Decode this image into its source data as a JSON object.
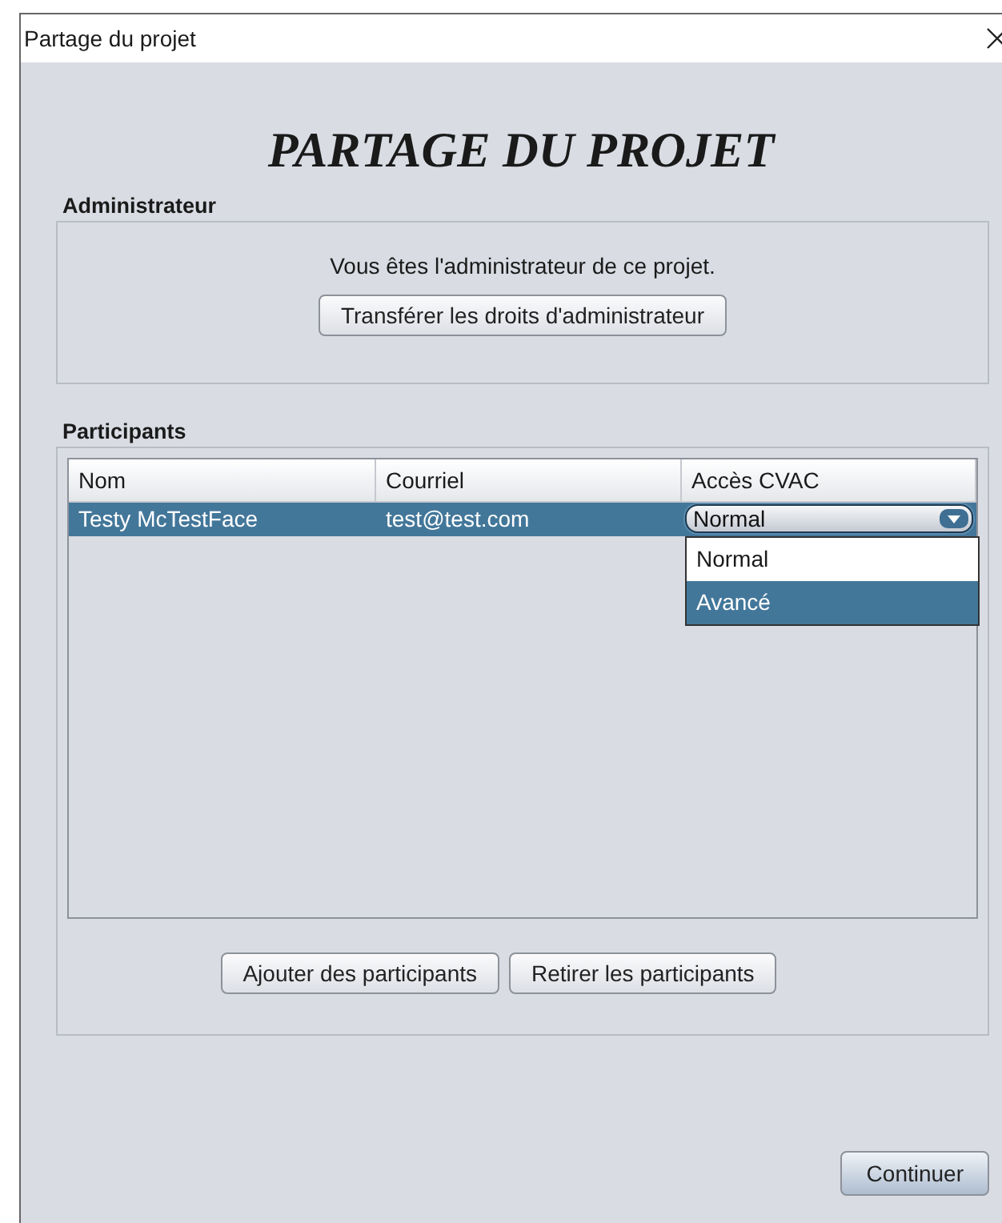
{
  "window": {
    "title": "Partage du projet"
  },
  "heading": "PARTAGE DU PROJET",
  "admin": {
    "label": "Administrateur",
    "message": "Vous êtes l'administrateur de ce projet.",
    "button": "Transférer les droits d'administrateur"
  },
  "participants": {
    "label": "Participants",
    "table": {
      "columns": [
        "Nom",
        "Courriel",
        "Accès CVAC"
      ],
      "rows": [
        {
          "name": "Testy McTestFace",
          "email": "test@test.com",
          "access": "Normal",
          "selected": true,
          "dropdown_open": true
        }
      ]
    },
    "dropdown_options": [
      {
        "label": "Normal",
        "selected": false
      },
      {
        "label": "Avancé",
        "selected": true
      }
    ],
    "buttons": [
      "Ajouter des participants",
      "Retirer les participants"
    ]
  },
  "footer": {
    "button": "Continuer"
  }
}
